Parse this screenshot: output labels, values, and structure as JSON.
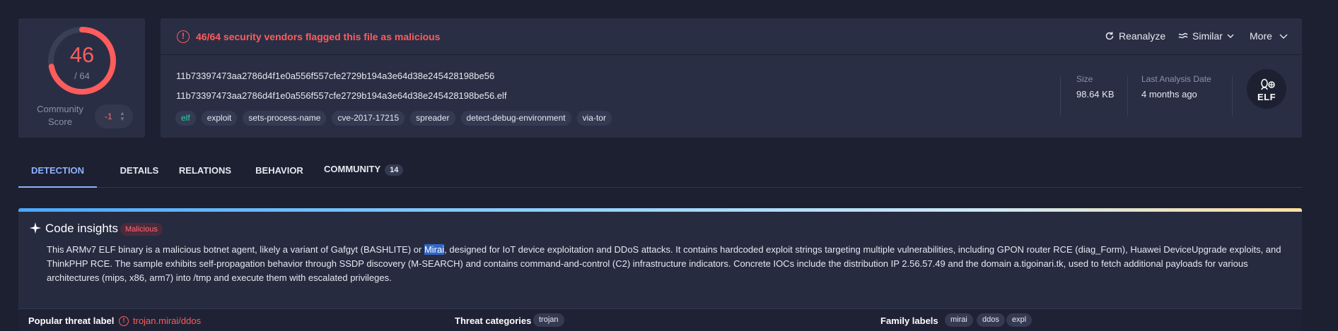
{
  "score": {
    "detections": "46",
    "total": "/ 64",
    "detection_fraction": 0.71875,
    "community_label": "Community Score",
    "community_value": "-1"
  },
  "header": {
    "flag_text": "46/64 security vendors flagged this file as malicious",
    "actions": {
      "reanalyze": "Reanalyze",
      "similar": "Similar",
      "more": "More"
    },
    "hash": "11b73397473aa2786d4f1e0a556f557cfe2729b194a3e64d38e245428198be56",
    "filename": "11b73397473aa2786d4f1e0a556f557cfe2729b194a3e64d38e245428198be56.elf",
    "tags": [
      "elf",
      "exploit",
      "sets-process-name",
      "cve-2017-17215",
      "spreader",
      "detect-debug-environment",
      "via-tor"
    ],
    "size_label": "Size",
    "size_value": "98.64 KB",
    "date_label": "Last Analysis Date",
    "date_value": "4 months ago",
    "file_type": "ELF"
  },
  "tabs": [
    {
      "label": "DETECTION"
    },
    {
      "label": "DETAILS"
    },
    {
      "label": "RELATIONS"
    },
    {
      "label": "BEHAVIOR"
    },
    {
      "label": "COMMUNITY",
      "count": "14"
    }
  ],
  "insights": {
    "title": "Code insights",
    "badge": "Malicious",
    "body_pre": "This ARMv7 ELF binary is a malicious botnet agent, likely a variant of Gafgyt (BASHLITE) or ",
    "body_highlight": "Mirai",
    "body_post": ", designed for IoT device exploitation and DDoS attacks. It contains hardcoded exploit strings targeting multiple vulnerabilities, including GPON router RCE (diag_Form), Huawei DeviceUpgrade exploits, and ThinkPHP RCE. The sample exhibits self-propagation behavior through SSDP discovery (M-SEARCH) and contains command-and-control (C2) infrastructure indicators. Concrete IOCs include the distribution IP 2.56.57.49 and the domain a.tigoinari.tk, used to fetch additional payloads for various architectures (mips, x86, arm7) into /tmp and execute them with escalated privileges."
  },
  "labels": {
    "popular_label": "Popular threat label",
    "popular_value": "trojan.mirai/ddos",
    "categories_label": "Threat categories",
    "categories": [
      "trojan"
    ],
    "family_label": "Family labels",
    "families": [
      "mirai",
      "ddos",
      "expl"
    ]
  },
  "colors": {
    "background": "#1d2031",
    "card": "#292e44",
    "danger": "#ff5c5c",
    "accent": "#8fb2ff",
    "tag_green": "#2ed3a0"
  }
}
